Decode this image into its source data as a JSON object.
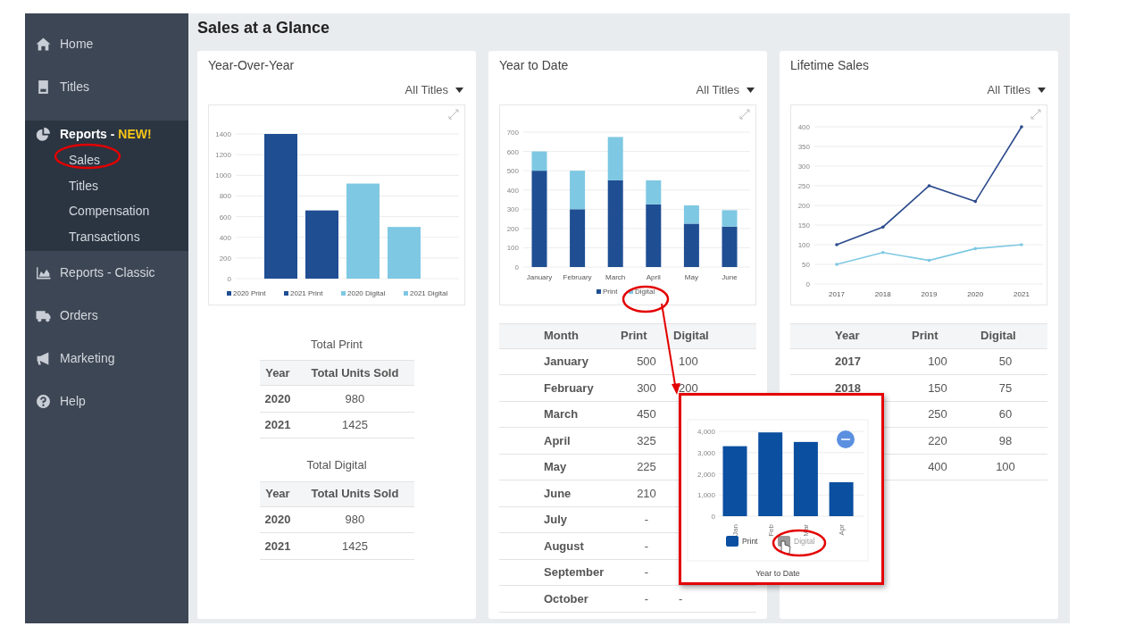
{
  "page": {
    "title": "Sales at a Glance"
  },
  "sidebar": {
    "items": [
      {
        "label": "Home",
        "expanded": false
      },
      {
        "label": "Titles",
        "expanded": false
      },
      {
        "label": "Reports - ",
        "tag": "NEW!",
        "expanded": true,
        "children": [
          {
            "label": "Sales"
          },
          {
            "label": "Titles"
          },
          {
            "label": "Compensation"
          },
          {
            "label": "Transactions"
          }
        ]
      },
      {
        "label": "Reports - Classic",
        "expanded": false
      },
      {
        "label": "Orders",
        "expanded": false
      },
      {
        "label": "Marketing",
        "expanded": false
      },
      {
        "label": "Help",
        "expanded": false
      }
    ]
  },
  "cards": [
    {
      "kind": "yoy",
      "title": "Year-Over-Year",
      "filter": "All Titles",
      "chart_data": {
        "type": "bar",
        "grid": true,
        "legend": "bottom",
        "series": [
          {
            "name": "2020 Print",
            "color": "#1f4e93",
            "values": [
              1400
            ]
          },
          {
            "name": "2021 Print",
            "color": "#1f4e93",
            "values": [
              660
            ]
          },
          {
            "name": "2020 Digital",
            "color": "#7ec8e3",
            "values": [
              920
            ]
          },
          {
            "name": "2021 Digital",
            "color": "#7ec8e3",
            "values": [
              500
            ]
          }
        ],
        "ylim": [
          0,
          1400
        ],
        "yticks": [
          {
            "value": 0,
            "label": "0"
          },
          {
            "value": 200,
            "label": "200"
          },
          {
            "value": 400,
            "label": "400"
          },
          {
            "value": 600,
            "label": "600"
          },
          {
            "value": 800,
            "label": "800"
          },
          {
            "value": 1000,
            "label": "1000"
          },
          {
            "value": 1200,
            "label": "1200"
          },
          {
            "value": 1400,
            "label": "1400"
          }
        ]
      },
      "tables": [
        {
          "caption": "Total Print",
          "columns": [
            "Year",
            "Total Units Sold"
          ],
          "rows": [
            [
              "2020",
              "980"
            ],
            [
              "2021",
              "1425"
            ]
          ]
        },
        {
          "caption": "Total Digital",
          "columns": [
            "Year",
            "Total Units Sold"
          ],
          "rows": [
            [
              "2020",
              "980"
            ],
            [
              "2021",
              "1425"
            ]
          ]
        }
      ]
    },
    {
      "kind": "ytd",
      "title": "Year to Date",
      "filter": "All Titles",
      "chart_data": {
        "type": "bar",
        "stacked": true,
        "grid": true,
        "legend": "bottom",
        "categories": [
          "January",
          "February",
          "March",
          "April",
          "May",
          "June"
        ],
        "series": [
          {
            "name": "Print",
            "color": "#1f4e93",
            "values": [
              500,
              300,
              450,
              325,
              225,
              210
            ]
          },
          {
            "name": "Digital",
            "color": "#7ec8e3",
            "values": [
              100,
              200,
              225,
              125,
              95,
              85
            ]
          }
        ],
        "ylim": [
          0,
          700
        ],
        "yticks": [
          {
            "value": 0,
            "label": "0"
          },
          {
            "value": 100,
            "label": "100"
          },
          {
            "value": 200,
            "label": "200"
          },
          {
            "value": 300,
            "label": "300"
          },
          {
            "value": 400,
            "label": "400"
          },
          {
            "value": 500,
            "label": "500"
          },
          {
            "value": 600,
            "label": "600"
          },
          {
            "value": 700,
            "label": "700"
          }
        ]
      },
      "tables": [
        {
          "columns": [
            "Month",
            "Print",
            "Digital"
          ],
          "rows": [
            [
              "January",
              "500",
              "100"
            ],
            [
              "February",
              "300",
              "200"
            ],
            [
              "March",
              "450",
              null
            ],
            [
              "April",
              "325",
              null
            ],
            [
              "May",
              "225",
              null
            ],
            [
              "June",
              "210",
              null
            ],
            [
              "July",
              "-",
              null
            ],
            [
              "August",
              "-",
              null
            ],
            [
              "September",
              "-",
              null
            ],
            [
              "October",
              "-",
              "-"
            ]
          ]
        }
      ]
    },
    {
      "kind": "lifetime",
      "title": "Lifetime Sales",
      "filter": "All Titles",
      "chart_data": {
        "type": "line",
        "grid": true,
        "categories": [
          "2017",
          "2018",
          "2019",
          "2020",
          "2021"
        ],
        "series": [
          {
            "color": "#2b4a8c",
            "values": [
              100,
              145,
              250,
              210,
              400
            ]
          },
          {
            "color": "#7ec8e3",
            "values": [
              50,
              80,
              60,
              90,
              100
            ]
          }
        ],
        "ylim": [
          0,
          400
        ],
        "yticks": [
          {
            "value": 0,
            "label": "0"
          },
          {
            "value": 50,
            "label": "50"
          },
          {
            "value": 100,
            "label": "100"
          },
          {
            "value": 150,
            "label": "150"
          },
          {
            "value": 200,
            "label": "200"
          },
          {
            "value": 250,
            "label": "250"
          },
          {
            "value": 300,
            "label": "300"
          },
          {
            "value": 350,
            "label": "350"
          },
          {
            "value": 400,
            "label": "400"
          }
        ]
      },
      "tables": [
        {
          "columns": [
            "Year",
            "Print",
            "Digital"
          ],
          "rows": [
            [
              "2017",
              "100",
              "50"
            ],
            [
              "2018",
              "150",
              "75"
            ],
            [
              null,
              "250",
              "60"
            ],
            [
              null,
              "220",
              "98"
            ],
            [
              null,
              "400",
              "100"
            ]
          ]
        }
      ]
    }
  ],
  "callout": {
    "chart_data": {
      "type": "bar",
      "grid": true,
      "title": "Year to Date",
      "categories": [
        "Jan",
        "Feb",
        "Mar",
        "Apr"
      ],
      "series": [
        {
          "color": "#0a4fa0",
          "values": [
            3300,
            3950,
            3500,
            1600
          ]
        }
      ],
      "ylim": [
        0,
        4000
      ],
      "yticks": [
        {
          "value": 0,
          "label": "0"
        },
        {
          "value": 1000,
          "label": "1,000"
        },
        {
          "value": 2000,
          "label": "2,000"
        },
        {
          "value": 3000,
          "label": "3,000"
        },
        {
          "value": 4000,
          "label": "4,000"
        }
      ]
    },
    "legend": [
      {
        "label": "Print",
        "on": true
      },
      {
        "label": "Digital",
        "on": false
      }
    ]
  }
}
